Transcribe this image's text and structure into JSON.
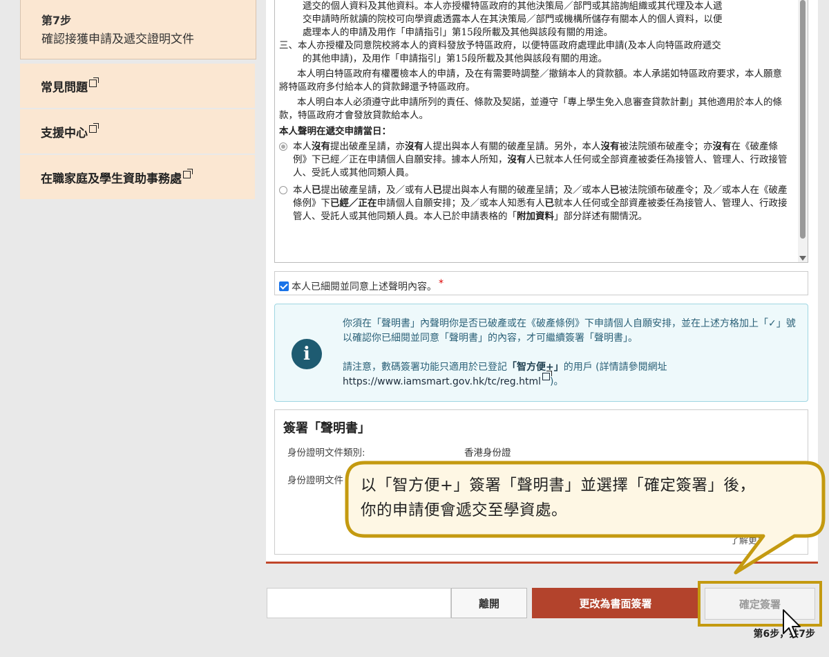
{
  "sidebar": {
    "step": {
      "number": "第7步",
      "title": "確認接獲申請及遞交證明文件"
    },
    "links": [
      {
        "label": "常見問題"
      },
      {
        "label": "支援中心"
      },
      {
        "label": "在職家庭及學生資助事務處"
      }
    ]
  },
  "declaration": {
    "line_top_1": "遞交的個人資料及其他資料。本人亦授權特區政府的其他決策局／部門或其諮詢組織或其代理及本人遞",
    "line_top_2": "交申請時所就讀的院校可向學資處透露本人在其決策局／部門或機構所儲存有關本人的個人資料，以便",
    "line_top_3": "處理本人的申請及用作「申請指引」第15段所載及其他與該段有關的用途。",
    "item3_1": "三、本人亦授權及同意院校將本人的資料發放予特區政府，以便特區政府處理此申請(及本人向特區政府遞交",
    "item3_2": "的其他申請)，及用作「申請指引」第15段所載及其他與該段有關的用途。",
    "para1": "本人明白特區政府有權覆檢本人的申請，及在有需要時調整／撤銷本人的貸款額。本人承諾如特區政府要求，本人願意將特區政府多付給本人的貸款歸還予特區政府。",
    "para2": "本人明白本人必須遵守此申請所列的責任、條款及契諾，並遵守「專上學生免入息審查貸款計劃」其他適用於本人的條款，特區政府才會發放貸款給本人。",
    "heading": "本人聲明在遞交申請當日：",
    "option1": {
      "a": "本人",
      "b": "沒有",
      "c": "提出破產呈請，亦",
      "d": "沒有",
      "e": "人提出與本人有關的破產呈請。另外，本人",
      "f": "沒有",
      "g": "被法院頒布破產令；亦",
      "h": "沒有",
      "i": "在《破產條例》下已經／正在申請個人自願安排。據本人所知，",
      "j": "沒有",
      "k": "人已就本人任何或全部資產被委任為接管人、管理人、行政接管人、受託人或其他同類人員。"
    },
    "option2": {
      "a": "本人",
      "b": "已",
      "c": "提出破產呈請，及／或有人",
      "d": "已",
      "e": "提出與本人有關的破產呈請；及／或本人",
      "f": "已",
      "g": "被法院頒布破產令；及／或本人在《破產條例》下",
      "h": "已經／正在",
      "i": "申請個人自願安排；及／或本人知悉有人",
      "j": "已",
      "k": "就本人任何或全部資產被委任為接管人、管理人、行政接管人、受託人或其他同類人員。本人已於申請表格的「",
      "l": "附加資料",
      "m": "」部分詳述有關情況。"
    }
  },
  "agree": {
    "label": "本人已細閱並同意上述聲明內容。",
    "required": "*",
    "checked": true
  },
  "info": {
    "p1": "你須在「聲明書」內聲明你是否已破產或在《破產條例》下申請個人自願安排，並在上述方格加上「✓」號以確認你已細閱並同意「聲明書」的內容，才可繼續簽署「聲明書」。",
    "p2_a": "請注意，數碼簽署功能只適用於已登記",
    "p2_b": "「智方便+」",
    "p2_c": "的用戶 (詳情請參閱網址",
    "url": "https://www.iamsmart.gov.hk/tc/reg.html",
    "p2_d": ")。"
  },
  "sign": {
    "title": "簽署「聲明書」",
    "doc_type_label": "身份證明文件類別:",
    "doc_type_value": "香港身份證",
    "doc_no_label": "身份證明文件",
    "learn_more": "了解更多"
  },
  "buttons": {
    "leave": "離開",
    "paper": "更改為書面簽署",
    "confirm": "確定簽署"
  },
  "step_counter": "第6步，共7步",
  "callout": {
    "line1": "以「智方便+」簽署「聲明書」並選擇「確定簽署」後，",
    "line2": "你的申請便會遞交至學資處。"
  },
  "colors": {
    "accent": "#b3432c",
    "highlight": "#c49a10",
    "info": "#1e5b71"
  }
}
